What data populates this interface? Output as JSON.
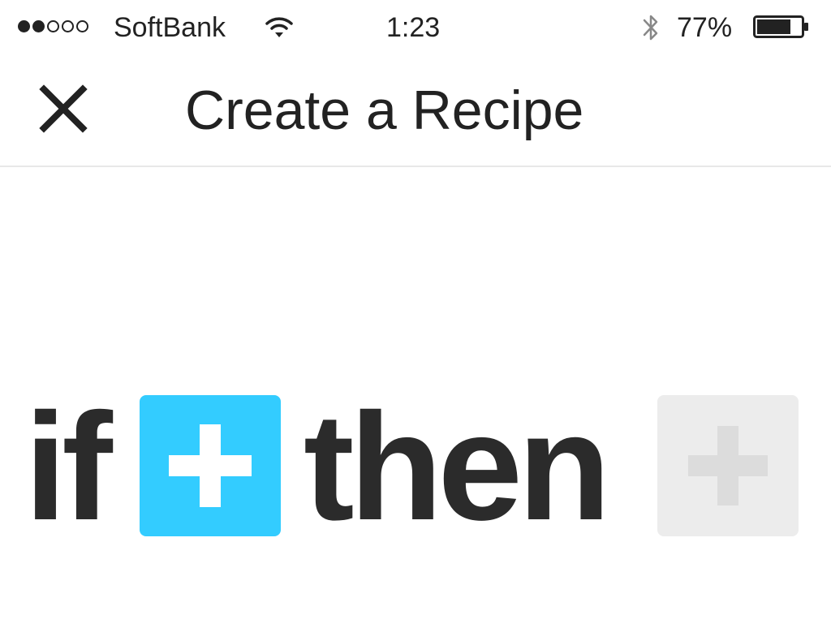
{
  "status_bar": {
    "carrier": "SoftBank",
    "signal_bars_filled": 2,
    "signal_bars_total": 5,
    "time": "1:23",
    "battery_percent": "77%",
    "battery_level": 0.77,
    "icons": [
      "wifi-icon",
      "bluetooth-icon",
      "battery-icon"
    ]
  },
  "nav_bar": {
    "title": "Create a Recipe",
    "close_icon": "close-icon"
  },
  "recipe": {
    "if_word": "if",
    "then_word": "then",
    "this_button_icon": "plus-icon",
    "that_button_icon": "plus-icon"
  },
  "colors": {
    "accent": "#33ccff",
    "disabled": "#ececec",
    "text": "#2b2b2b"
  }
}
